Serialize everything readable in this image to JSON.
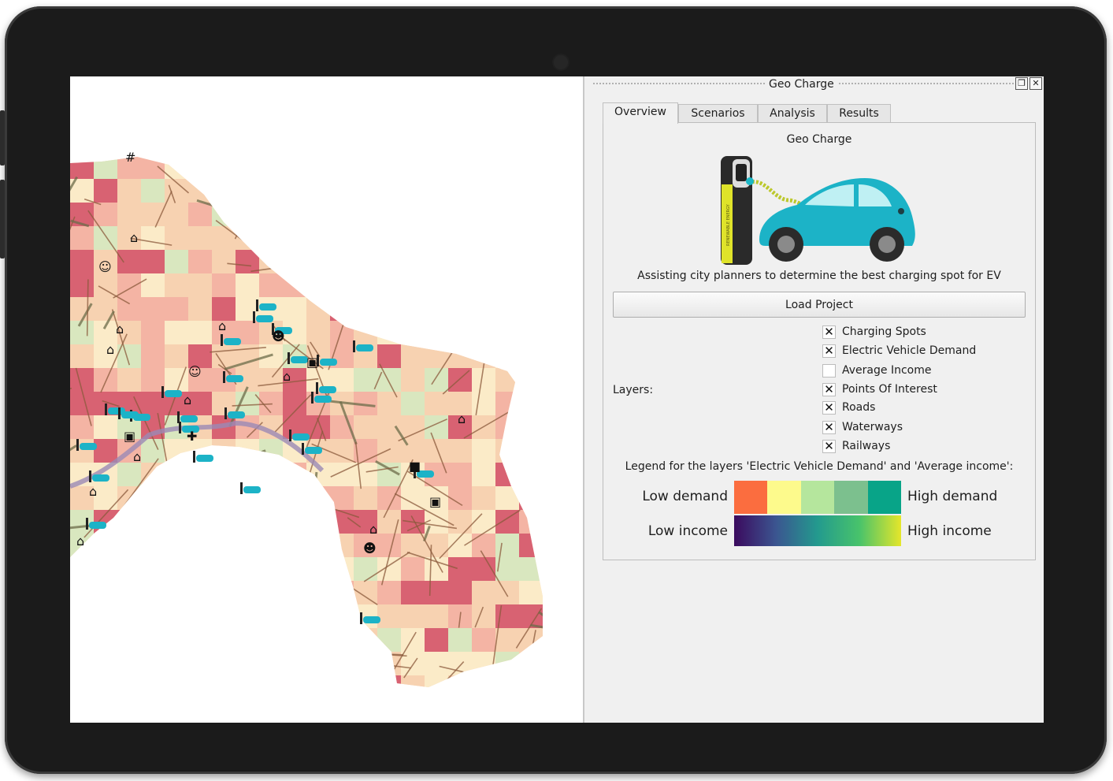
{
  "panel": {
    "window_title": "Geo Charge",
    "tabs": [
      "Overview",
      "Scenarios",
      "Analysis",
      "Results"
    ],
    "active_tab": "Overview",
    "app_title": "Geo Charge",
    "tagline": "Assisting city planners to determine the best charging spot for EV",
    "load_button": "Load Project",
    "layers_label": "Layers:",
    "layers": [
      {
        "label": "Charging Spots",
        "checked": true
      },
      {
        "label": "Electric Vehicle Demand",
        "checked": true
      },
      {
        "label": "Average Income",
        "checked": false
      },
      {
        "label": "Points Of Interest",
        "checked": true
      },
      {
        "label": "Roads",
        "checked": true
      },
      {
        "label": "Waterways",
        "checked": true
      },
      {
        "label": "Railways",
        "checked": true
      }
    ],
    "legend_title": "Legend for the layers 'Electric Vehicle Demand' and 'Average income':",
    "demand_low": "Low demand",
    "demand_high": "High demand",
    "income_low": "Low income",
    "income_high": "High income",
    "demand_colors": [
      "#fb6d3f",
      "#fdfa8c",
      "#b5e69d",
      "#7cc08e",
      "#08a488"
    ],
    "income_colors": [
      "#3b0a5e",
      "#3b5590",
      "#239a8e",
      "#48c36b",
      "#e5e62a"
    ],
    "charger_label": "RENEWABLE ENERGY"
  },
  "map": {
    "demand_colors": [
      "#d2506a",
      "#f3b0a4",
      "#f7d3b4",
      "#fbf1cf",
      "#d3ecc4"
    ],
    "road_color": "#8b5a3c",
    "area_color": "#f7c9a2"
  }
}
